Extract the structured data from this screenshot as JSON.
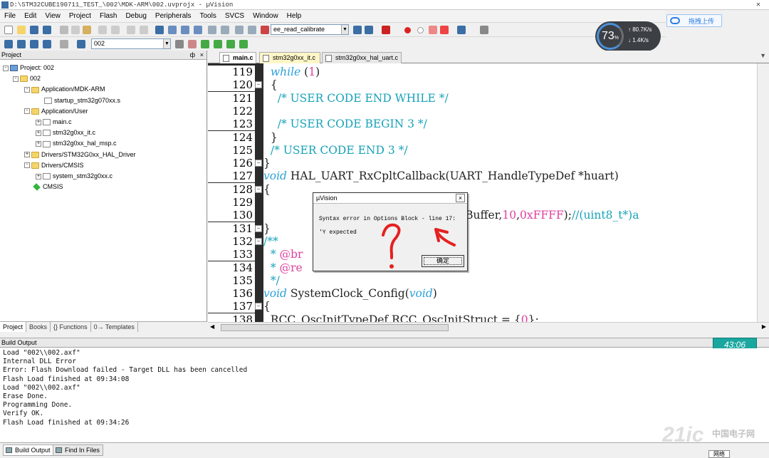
{
  "window": {
    "title": "D:\\STM32CUBE190711_TEST_\\002\\MDK-ARM\\002.uvprojx - µVision"
  },
  "menu": [
    "File",
    "Edit",
    "View",
    "Project",
    "Flash",
    "Debug",
    "Peripherals",
    "Tools",
    "SVCS",
    "Window",
    "Help"
  ],
  "toolbar": {
    "find_combo": "ee_read_calibrate",
    "target_combo": "002"
  },
  "upload_badge": {
    "label": "拖拽上传"
  },
  "net_gauge": {
    "percent": "73",
    "percent_unit": "%",
    "up": "80.7",
    "down": "1.4",
    "unit": "K/s"
  },
  "project_panel": {
    "title": "Project",
    "tree": [
      {
        "label": "Project: 002",
        "icon": "root-icon"
      },
      {
        "label": "002",
        "icon": "target-icon"
      },
      {
        "label": "Application/MDK-ARM",
        "icon": "folder-icon"
      },
      {
        "label": "startup_stm32g070xx.s",
        "icon": "file-icon"
      },
      {
        "label": "Application/User",
        "icon": "folder-icon"
      },
      {
        "label": "main.c",
        "icon": "file-icon"
      },
      {
        "label": "stm32g0xx_it.c",
        "icon": "file-icon"
      },
      {
        "label": "stm32g0xx_hal_msp.c",
        "icon": "file-icon"
      },
      {
        "label": "Drivers/STM32G0xx_HAL_Driver",
        "icon": "folder-icon"
      },
      {
        "label": "Drivers/CMSIS",
        "icon": "folder-icon"
      },
      {
        "label": "system_stm32g0xx.c",
        "icon": "file-icon"
      },
      {
        "label": "CMSIS",
        "icon": "gem-icon"
      }
    ],
    "tabs": [
      "Project",
      "Books",
      "{} Functions",
      "0→ Templates"
    ]
  },
  "editor": {
    "tabs": [
      "main.c",
      "stm32g0xx_it.c",
      "stm32g0xx_hal_uart.c"
    ],
    "lines": [
      {
        "n": "119",
        "html": "  <span class=\"kw\">while</span> (<span class=\"num\">1</span>)"
      },
      {
        "n": "120",
        "html": "  {"
      },
      {
        "n": "121",
        "html": "    <span class=\"cm\">/* USER CODE END WHILE */</span>"
      },
      {
        "n": "122",
        "html": ""
      },
      {
        "n": "123",
        "html": "    <span class=\"cm\">/* USER CODE BEGIN 3 */</span>"
      },
      {
        "n": "124",
        "html": "  }"
      },
      {
        "n": "125",
        "html": "  <span class=\"cm\">/* USER CODE END 3 */</span>"
      },
      {
        "n": "126",
        "html": "}"
      },
      {
        "n": "127",
        "html": "<span class=\"kw\">void</span> HAL_UART_RxCpltCallback(UART_HandleTypeDef *huart)"
      },
      {
        "n": "128",
        "html": "{"
      },
      {
        "n": "129",
        "html": ""
      },
      {
        "n": "130",
        "html": "                                t1,(uint8_t*)aRxBuffer,<span class=\"num\">10</span>,<span class=\"num\">0xFFFF</span>);<span class=\"cm\">//(uint8_t*)a</span>"
      },
      {
        "n": "131",
        "html": "}"
      },
      {
        "n": "132",
        "html": "<span class=\"cm\">/**</span>"
      },
      {
        "n": "133",
        "html": "<span class=\"cm\">  * <span class=\"hl\">@br</span>                            ration</span>"
      },
      {
        "n": "134",
        "html": "<span class=\"cm\">  * <span class=\"hl\">@re</span></span>"
      },
      {
        "n": "135",
        "html": "<span class=\"cm\">  */</span>"
      },
      {
        "n": "136",
        "html": "<span class=\"kw\">void</span> SystemClock_Config(<span class=\"kw\">void</span>)"
      },
      {
        "n": "137",
        "html": "{"
      },
      {
        "n": "138",
        "html": "  RCC_OscInitTypeDef RCC_OscInitStruct = {<span class=\"num\">0</span>};"
      }
    ],
    "fold_lines": [
      "120",
      "126",
      "128",
      "131",
      "132",
      "137"
    ]
  },
  "dialog": {
    "title": "µVision",
    "message": "Syntax error in Options Block - line 17:",
    "detail": "'Y  expected",
    "ok_label": "确定",
    "close": "×"
  },
  "build_output": {
    "title": "Build Output",
    "clock": "43:06",
    "lines": [
      "Load \"002\\\\002.axf\"",
      "Internal DLL Error",
      "Error: Flash Download failed  -  Target DLL has been cancelled",
      "Flash Load finished at 09:34:08",
      "Load \"002\\\\002.axf\"",
      "Erase Done.",
      "Programming Done.",
      "Verify OK.",
      "Flash Load finished at 09:34:26"
    ],
    "tabs": [
      "Build Output",
      "Find In Files"
    ]
  },
  "watermark": {
    "big": "21ic",
    "small": "中国电子网",
    "net": "网络"
  },
  "colors": {
    "accent": "#2d7ee0",
    "annotation": "#e52020",
    "clock": "#1aa7a0"
  }
}
